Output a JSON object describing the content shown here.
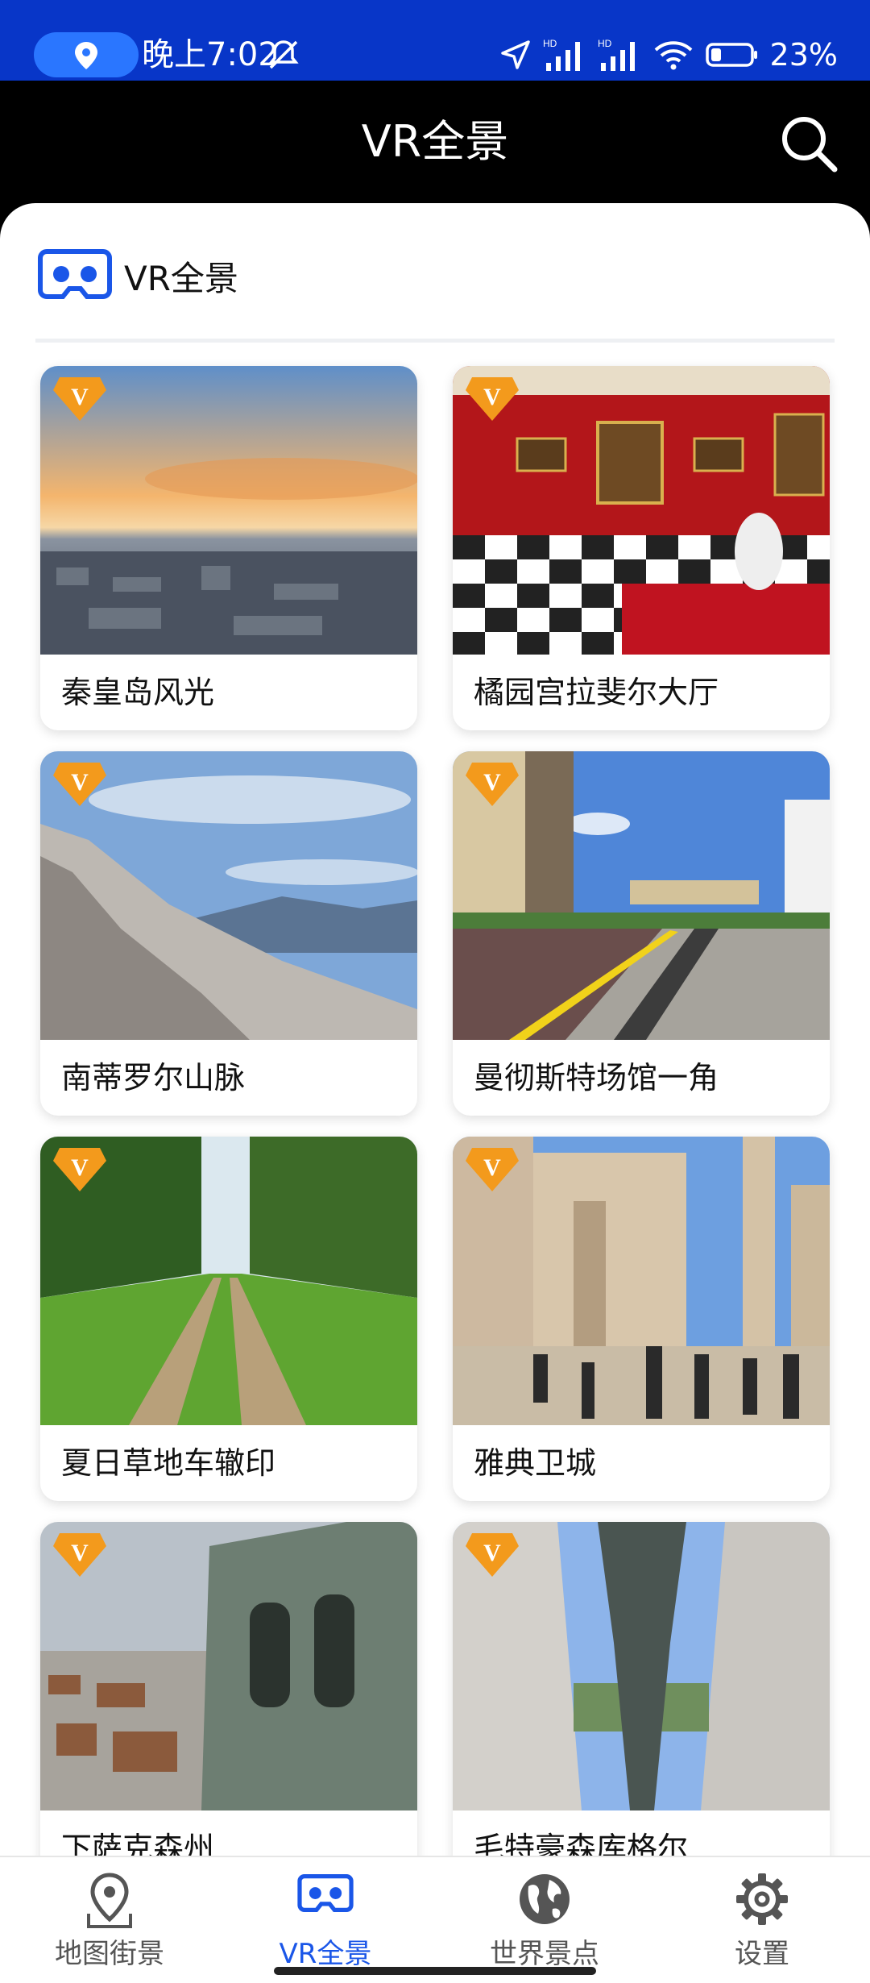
{
  "status_bar": {
    "time": "晚上7:02",
    "battery": "23%"
  },
  "header": {
    "title": "VR全景"
  },
  "section": {
    "title": "VR全景"
  },
  "cards": [
    {
      "label": "秦皇岛风光"
    },
    {
      "label": "橘园宫拉斐尔大厅"
    },
    {
      "label": "南蒂罗尔山脉"
    },
    {
      "label": "曼彻斯特场馆一角"
    },
    {
      "label": "夏日草地车辙印"
    },
    {
      "label": "雅典卫城"
    },
    {
      "label": "下萨克森州"
    },
    {
      "label": "毛特豪森库格尔"
    }
  ],
  "nav": {
    "items": [
      {
        "label": "地图街景",
        "icon": "map-pin-icon"
      },
      {
        "label": "VR全景",
        "icon": "vr-goggles-icon"
      },
      {
        "label": "世界景点",
        "icon": "globe-icon"
      },
      {
        "label": "设置",
        "icon": "gear-icon"
      }
    ]
  },
  "colors": {
    "status_bar": "#0836c8",
    "accent": "#1a56e8",
    "badge": "#f39a1c"
  }
}
